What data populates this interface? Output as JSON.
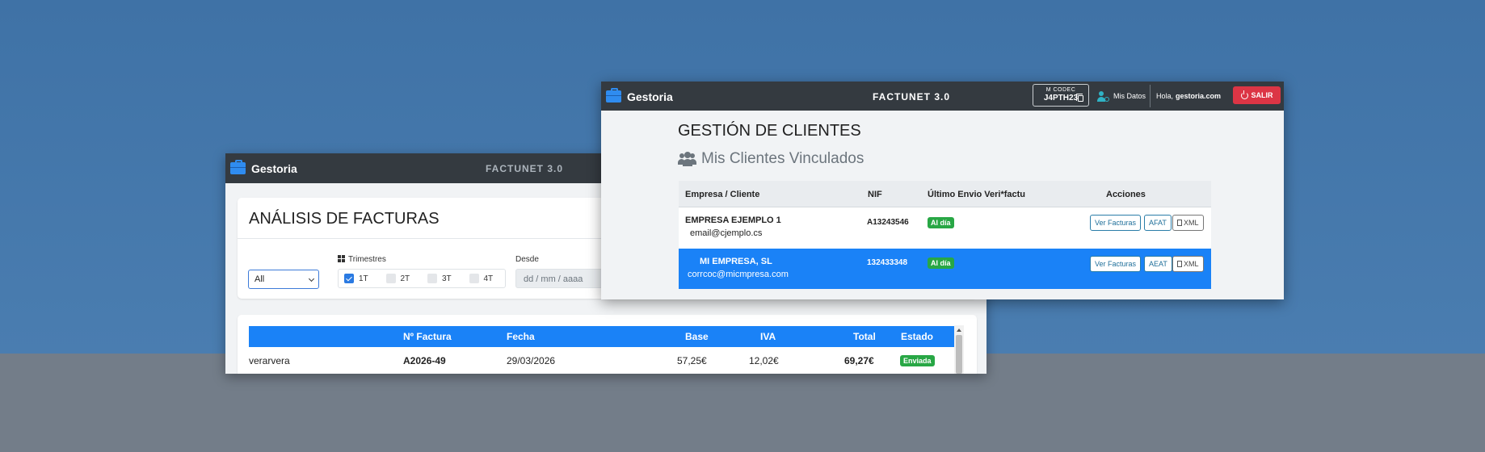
{
  "w1": {
    "brand": "Gestoria",
    "app_title": "FACTUNET 3.0",
    "page_title": "ANÁLISIS DE FACTURAS",
    "filters": {
      "client_select_value": "All",
      "trimestres_label": "Trimestres",
      "quarters": [
        "1T",
        "2T",
        "3T",
        "4T"
      ],
      "quarter_checked": [
        true,
        false,
        false,
        false
      ],
      "desde_label": "Desde",
      "desde_placeholder": "dd / mm / aaaa"
    },
    "table": {
      "headers": [
        "Nº Factura",
        "Fecha",
        "Base",
        "IVA",
        "Total",
        "Estado"
      ],
      "rows": [
        {
          "cliente": "verarvera",
          "factura": "A2026-49",
          "fecha": "29/03/2026",
          "base": "57,25€",
          "iva": "12,02€",
          "total": "69,27€",
          "estado": "Enviada"
        }
      ]
    }
  },
  "w2": {
    "brand": "Gestoria",
    "app_title": "FACTUNET 3.0",
    "code_label": "M CODEC",
    "code_value": "J4PTH23",
    "mis_datos": "Mis Datos",
    "hola": "Hola,",
    "user": "gestoria.com",
    "salir": "SALIR",
    "page_title": "GESTIÓN DE CLIENTES",
    "subtitle": "Mis Clientes Vinculados",
    "table": {
      "headers": [
        "Empresa / Cliente",
        "NIF",
        "Último Envio Veri*factu",
        "Acciones"
      ],
      "rows": [
        {
          "empresa": "EMPRESA EJEMPLO 1",
          "email": "email@cjemplo.cs",
          "nif": "A13243546",
          "estado": "Al día",
          "btn_ver": "Ver Facturas",
          "btn_aeat": "AFAT",
          "btn_xml": "XML"
        },
        {
          "empresa": "MI EMPRESA, SL",
          "email": "corrcoc@micmpresa.com",
          "nif": "132433348",
          "estado": "Al día",
          "btn_ver": "Ver Facturas",
          "btn_aeat": "AEAT",
          "btn_xml": "XML"
        }
      ]
    }
  },
  "colors": {
    "navbar": "#343a40",
    "primary": "#1a82f7",
    "success": "#28a745",
    "danger": "#dc3545"
  }
}
